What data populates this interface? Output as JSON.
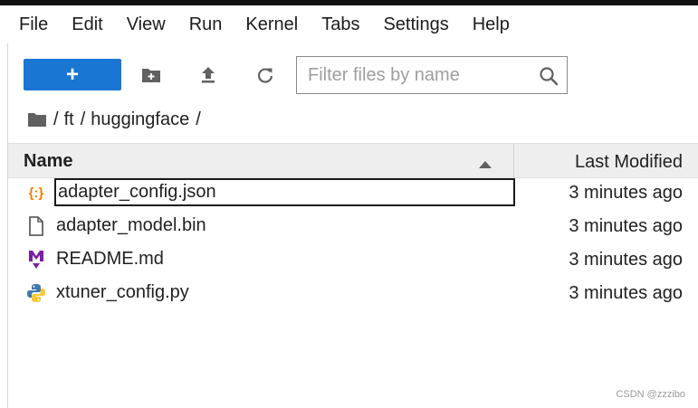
{
  "menu": [
    "File",
    "Edit",
    "View",
    "Run",
    "Kernel",
    "Tabs",
    "Settings",
    "Help"
  ],
  "toolbar": {
    "new_label": "+",
    "search_placeholder": "Filter files by name",
    "accent_color": "#1976d2"
  },
  "breadcrumb": {
    "root_icon": "folder-icon",
    "sep": "/",
    "segments": [
      "ft",
      "huggingface"
    ]
  },
  "list": {
    "col_name": "Name",
    "col_modified": "Last Modified",
    "sort": "ascending",
    "files": [
      {
        "name": "adapter_config.json",
        "modified": "3 minutes ago",
        "icon": "json-icon",
        "selected": true
      },
      {
        "name": "adapter_model.bin",
        "modified": "3 minutes ago",
        "icon": "file-icon",
        "selected": false
      },
      {
        "name": "README.md",
        "modified": "3 minutes ago",
        "icon": "markdown-icon",
        "selected": false
      },
      {
        "name": "xtuner_config.py",
        "modified": "3 minutes ago",
        "icon": "python-icon",
        "selected": false
      }
    ]
  },
  "watermark": "CSDN @zzzibo"
}
